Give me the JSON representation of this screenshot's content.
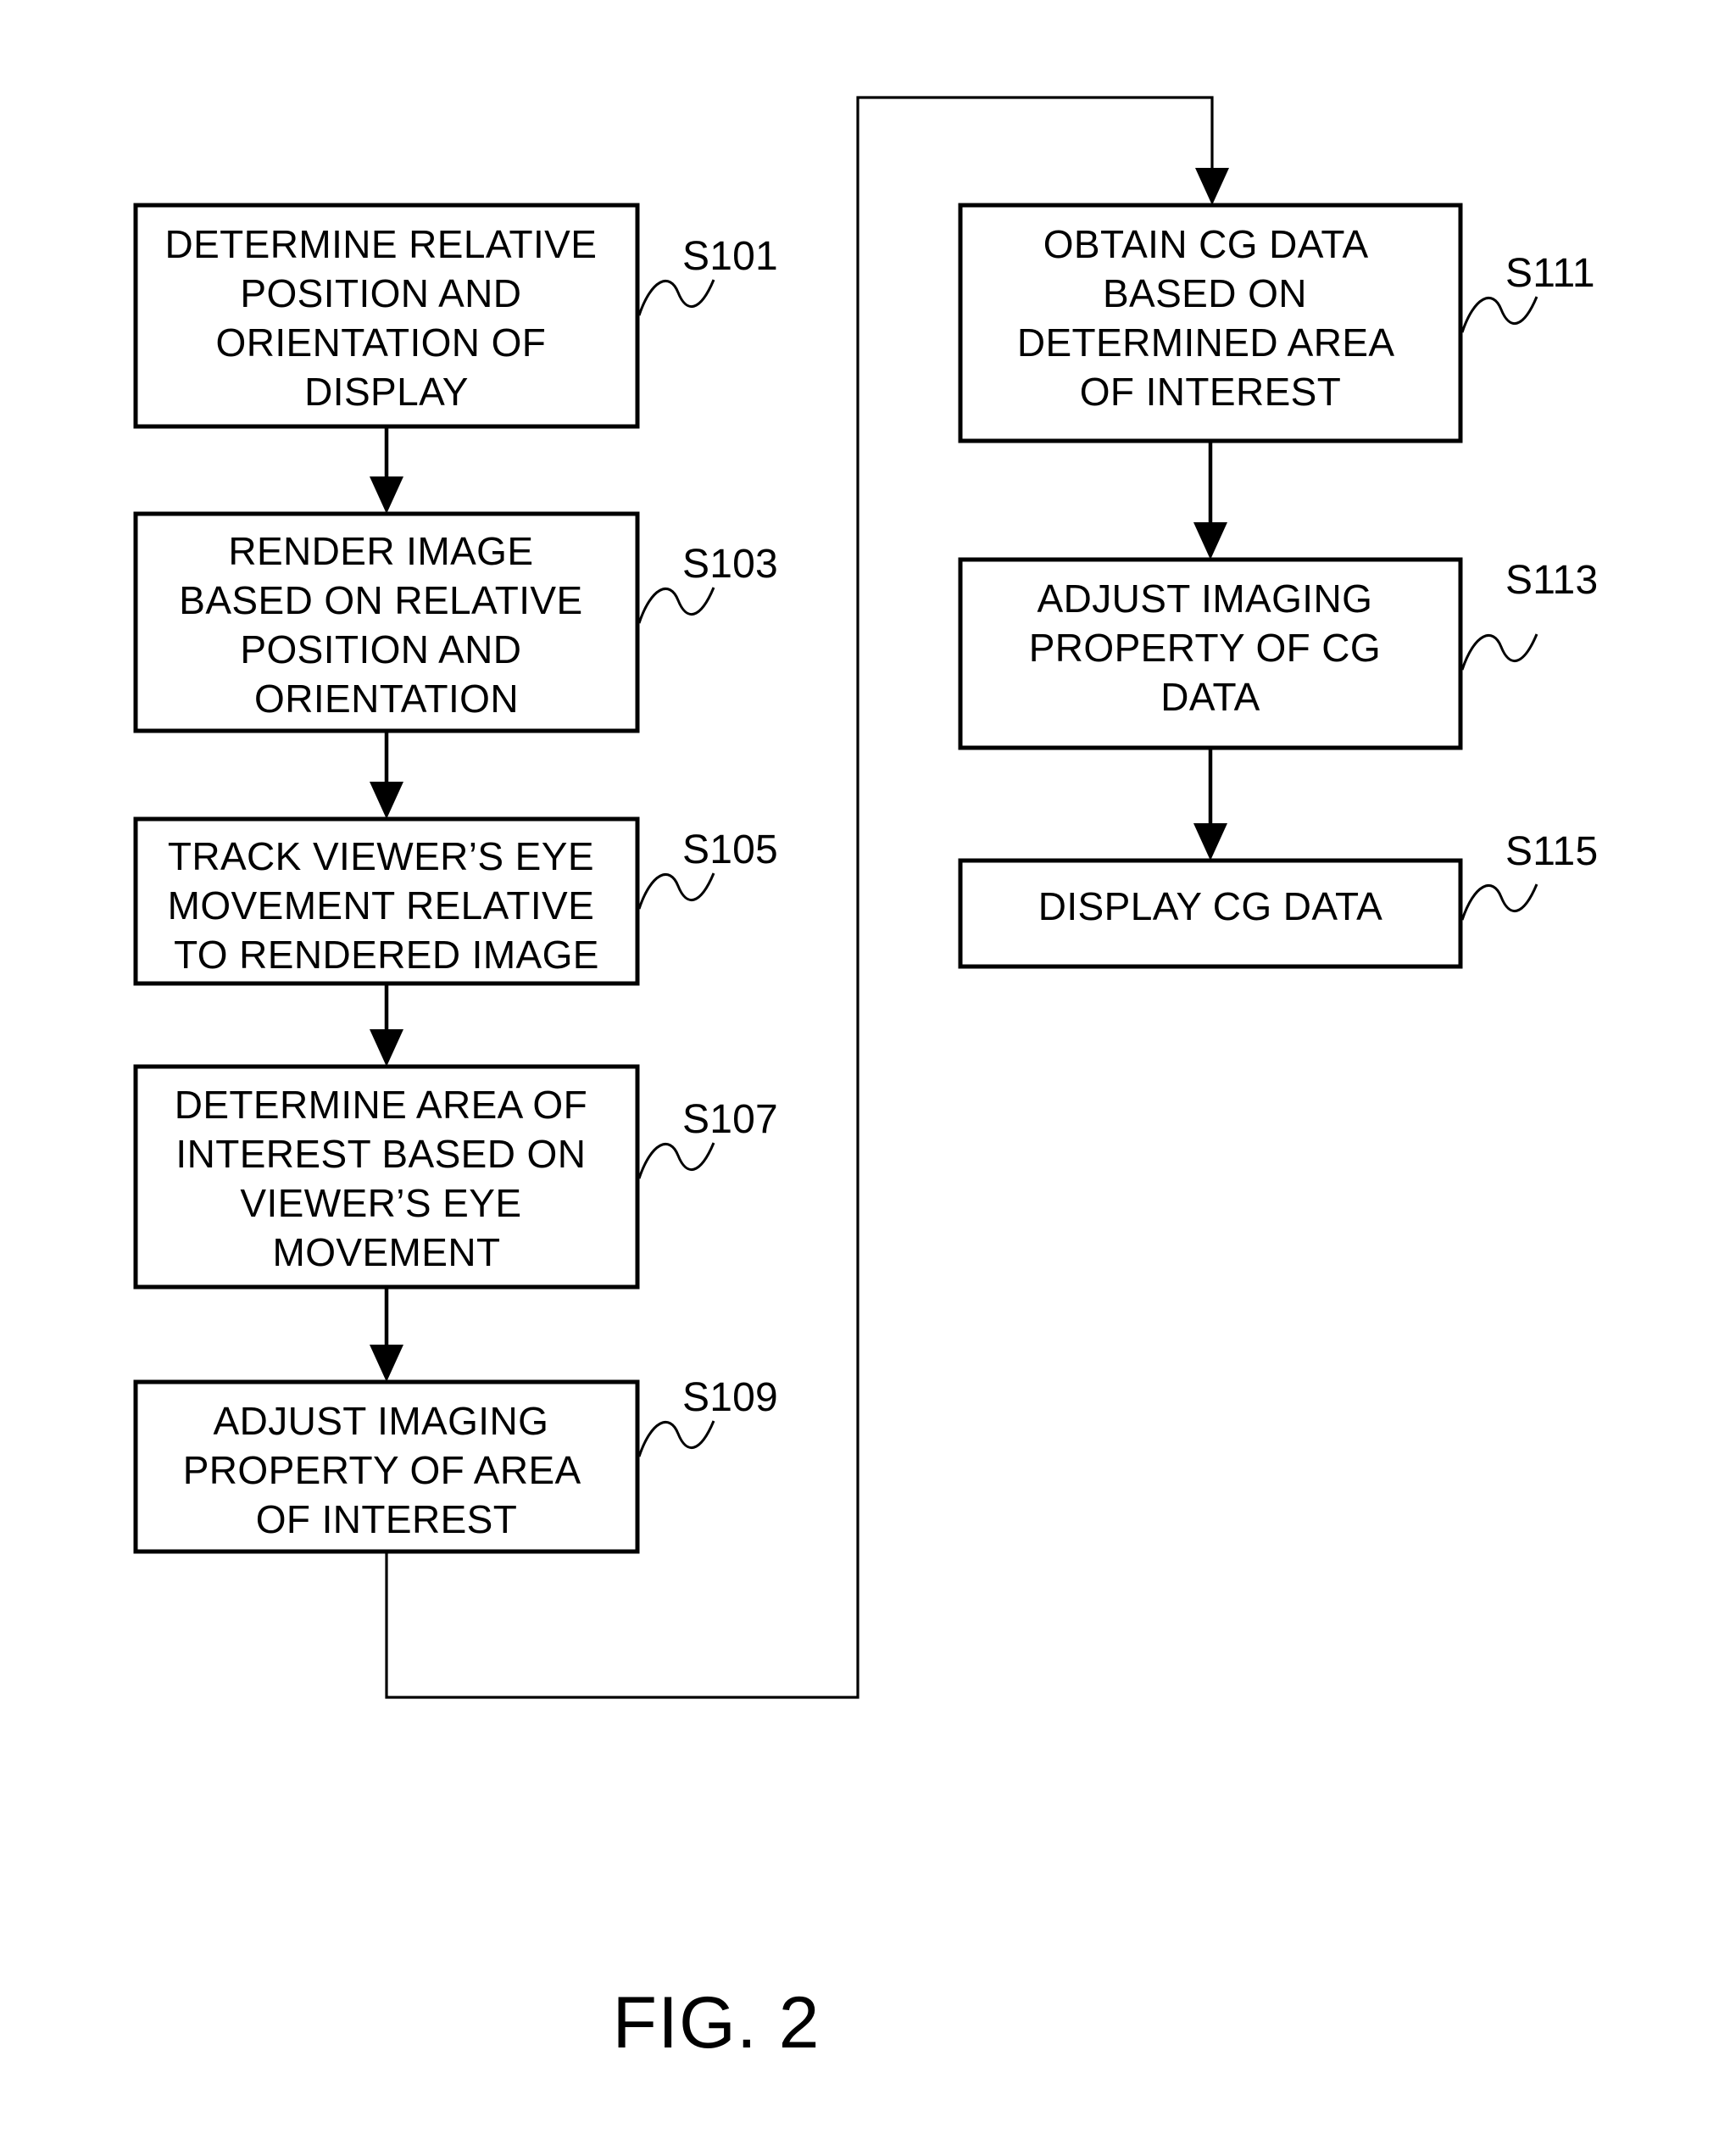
{
  "figure": {
    "caption": "FIG. 2",
    "type": "patent-flowchart",
    "background_color": "#ffffff",
    "line_color": "#000000"
  },
  "flowchart": {
    "left_column": [
      {
        "id": "S101",
        "step_label": "S101",
        "lines": [
          "DETERMINE RELATIVE",
          "POSITION AND",
          "ORIENTATION OF",
          "DISPLAY"
        ]
      },
      {
        "id": "S103",
        "step_label": "S103",
        "lines": [
          "RENDER IMAGE",
          "BASED ON RELATIVE",
          "POSITION AND",
          "ORIENTATION"
        ]
      },
      {
        "id": "S105",
        "step_label": "S105",
        "lines": [
          "TRACK VIEWER’S EYE",
          "MOVEMENT RELATIVE",
          "TO RENDERED IMAGE"
        ]
      },
      {
        "id": "S107",
        "step_label": "S107",
        "lines": [
          "DETERMINE AREA OF",
          "INTEREST BASED ON",
          "VIEWER’S EYE",
          "MOVEMENT"
        ]
      },
      {
        "id": "S109",
        "step_label": "S109",
        "lines": [
          "ADJUST IMAGING",
          "PROPERTY OF AREA",
          "OF INTEREST"
        ]
      }
    ],
    "right_column": [
      {
        "id": "S111",
        "step_label": "S111",
        "lines": [
          "OBTAIN CG DATA",
          "BASED ON",
          "DETERMINED AREA",
          "OF INTEREST"
        ]
      },
      {
        "id": "S113",
        "step_label": "S113",
        "lines": [
          "ADJUST IMAGING",
          "PROPERTY OF CG",
          "DATA"
        ]
      },
      {
        "id": "S115",
        "step_label": "S115",
        "lines": [
          "DISPLAY CG DATA"
        ]
      }
    ],
    "connectors": [
      {
        "name": "s101-to-s103",
        "kind": "arrow-down"
      },
      {
        "name": "s103-to-s105",
        "kind": "arrow-down"
      },
      {
        "name": "s105-to-s107",
        "kind": "arrow-down"
      },
      {
        "name": "s107-to-s109",
        "kind": "arrow-down"
      },
      {
        "name": "s109-to-s111",
        "kind": "routed-loop-arrow"
      },
      {
        "name": "s111-to-s113",
        "kind": "arrow-down"
      },
      {
        "name": "s113-to-s115",
        "kind": "arrow-down"
      }
    ]
  }
}
